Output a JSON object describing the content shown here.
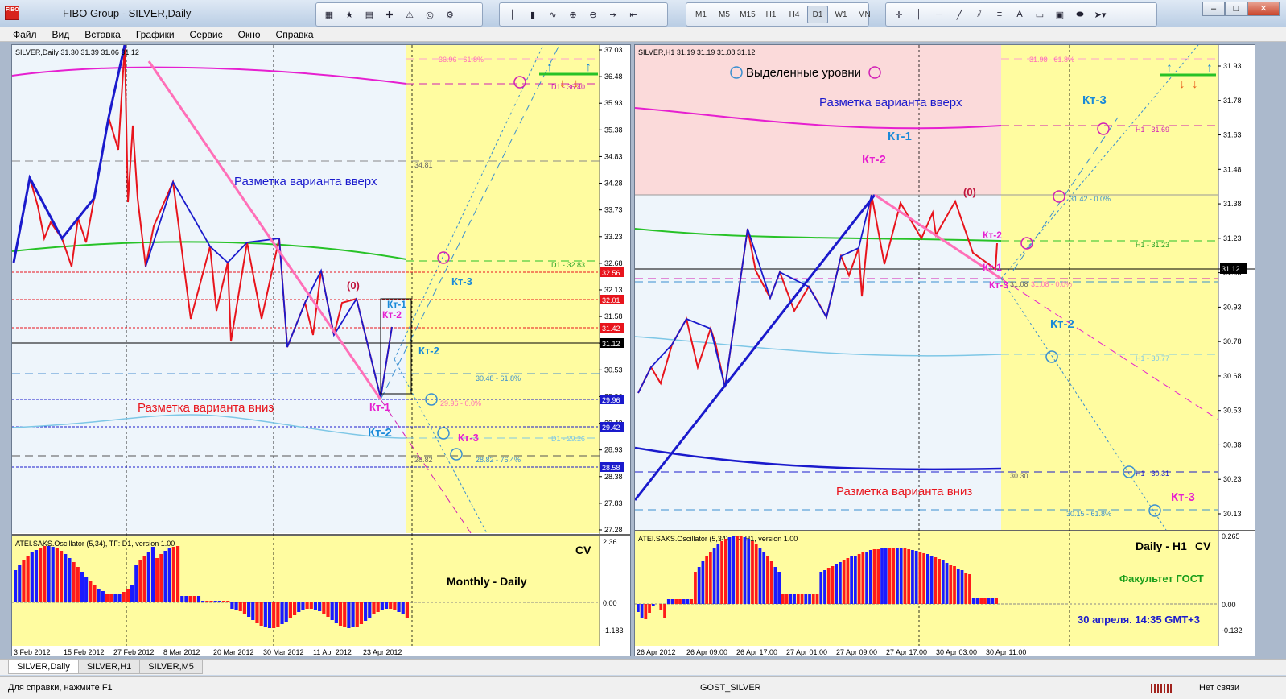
{
  "window": {
    "title": "FIBO Group - SILVER,Daily",
    "logo": "FIBO"
  },
  "toolbar_timeframes": [
    "M1",
    "M5",
    "M15",
    "H1",
    "H4",
    "D1",
    "W1",
    "MN"
  ],
  "toolbar_active_tf": "D1",
  "menu": [
    "Файл",
    "Вид",
    "Вставка",
    "Графики",
    "Сервис",
    "Окно",
    "Справка"
  ],
  "left_chart": {
    "header": "SILVER,Daily  31.30 31.39 31.06 31.12",
    "price_ticks": [
      "37.03",
      "36.48",
      "35.93",
      "35.38",
      "34.83",
      "34.28",
      "33.73",
      "33.23",
      "32.68",
      "32.13",
      "31.58",
      "31.03",
      "30.53",
      "29.96",
      "29.42",
      "28.93",
      "28.38",
      "27.83",
      "27.28"
    ],
    "price_tags": [
      {
        "v": "32.56",
        "color": "#e8141c"
      },
      {
        "v": "32.01",
        "color": "#e8141c"
      },
      {
        "v": "31.42",
        "color": "#e8141c"
      },
      {
        "v": "31.12",
        "color": "#000000"
      },
      {
        "v": "29.96",
        "color": "#1a1acc"
      },
      {
        "v": "29.42",
        "color": "#1a1acc"
      },
      {
        "v": "28.58",
        "color": "#1a1acc"
      }
    ],
    "level_labels": [
      "36.96 - 61.8%",
      "D1 - 36.40",
      "34.81",
      "D1 - 32.83",
      "30.48 - 61.8%",
      "29.96 - 0.0%",
      "D1 - 29.26",
      "28.82",
      "28.82 - 76.4%"
    ],
    "annotations": {
      "up": "Разметка варианта вверх",
      "down": "Разметка варианта вниз",
      "zero": "(0)",
      "kt1_top": "Кт-1",
      "kt2_top": "Кт-2",
      "kt2_right": "Кт-2",
      "kt3_right": "Кт-3",
      "kt1_bottom": "Кт-1",
      "kt2_bottom": "Кт-2",
      "kt3_bottom": "Кт-3"
    },
    "oscillator": {
      "header": "ATEI.SAKS.Oscillator (5,34), TF: D1, version 1.00",
      "ticks": [
        "2.36",
        "0.00",
        "-1.183"
      ],
      "cv": "CV",
      "label": "Monthly - Daily"
    },
    "dates": [
      "3 Feb 2012",
      "15 Feb 2012",
      "27 Feb 2012",
      "8 Mar 2012",
      "20 Mar 2012",
      "30 Mar 2012",
      "11 Apr 2012",
      "23 Apr 2012"
    ]
  },
  "right_chart": {
    "header": "SILVER,H1  31.19 31.19 31.08 31.12",
    "price_ticks": [
      "31.93",
      "31.78",
      "31.63",
      "31.48",
      "31.38",
      "31.23",
      "31.08",
      "30.93",
      "30.78",
      "30.68",
      "30.53",
      "30.38",
      "30.23",
      "30.13"
    ],
    "price_tag": "31.12",
    "level_labels": [
      "31.98 - 61.8%",
      "H1 - 31.69",
      "31.42 - 0.0%",
      "H1 - 31.23",
      "31.08",
      "31.08 - 0.0%",
      "H1 - 30.77",
      "30.30",
      "H1 - 30.31",
      "30.15 - 61.8%"
    ],
    "annotations": {
      "legend": "Выделенные уровни",
      "up": "Разметка варианта вверх",
      "down": "Разметка варианта вниз",
      "zero": "(0)",
      "kt1": "Кт-1",
      "kt2": "Кт-2",
      "kt3_top": "Кт-3",
      "kt2_mid": "Кт-2",
      "kt1_mid": "Кт-1",
      "kt3_mid": "Кт-3",
      "kt2_right": "Кт-2",
      "kt3_bottom": "Кт-3"
    },
    "oscillator": {
      "header": "ATEI.SAKS.Oscillator (5,34), TF: H1, version 1.00",
      "ticks": [
        "0.265",
        "0.00",
        "-0.132"
      ],
      "cv": "CV",
      "label1": "Daily - H1",
      "label2": "Факультет ГОСТ",
      "label3": "30 апреля. 14:35 GMT+3"
    },
    "dates": [
      "26 Apr 2012",
      "26 Apr 09:00",
      "26 Apr 17:00",
      "27 Apr 01:00",
      "27 Apr 09:00",
      "27 Apr 17:00",
      "30 Apr 03:00",
      "30 Apr 11:00"
    ]
  },
  "tabs": [
    "SILVER,Daily",
    "SILVER,H1",
    "SILVER,M5"
  ],
  "active_tab": "SILVER,Daily",
  "status": {
    "help": "Для справки, нажмите F1",
    "profile": "GOST_SILVER",
    "connection": "Нет связи"
  }
}
